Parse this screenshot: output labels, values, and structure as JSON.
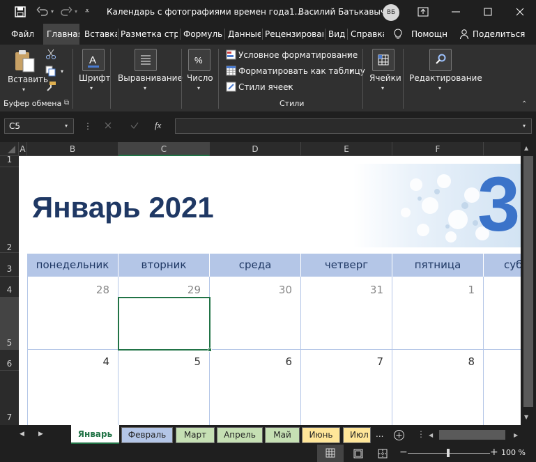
{
  "titlebar": {
    "doc_title": "Календарь с фотографиями времен года1...",
    "user_name": "Василий Батькавыч",
    "avatar_initials": "ВБ"
  },
  "tabs": [
    "Файл",
    "Главная",
    "Вставка",
    "Разметка стра",
    "Формулы",
    "Данные",
    "Рецензировани",
    "Вид",
    "Справка",
    "Помощн",
    "Поделиться"
  ],
  "ribbon": {
    "paste": "Вставить",
    "clipboard": "Буфер обмена",
    "font": "Шрифт",
    "align": "Выравнивание",
    "number": "Число",
    "cond_format": "Условное форматирование",
    "format_table": "Форматировать как таблицу",
    "cell_styles": "Стили ячеек",
    "styles": "Стили",
    "cells": "Ячейки",
    "editing": "Редактирование"
  },
  "formula": {
    "name_box": "C5",
    "fx": "fx"
  },
  "columns": [
    "A",
    "B",
    "C",
    "D",
    "E",
    "F"
  ],
  "rows": [
    "1",
    "2",
    "3",
    "4",
    "5",
    "6",
    "7"
  ],
  "calendar": {
    "title": "Январь 2021",
    "banner_number": "3",
    "days": [
      "понедельник",
      "вторник",
      "среда",
      "четверг",
      "пятница",
      "суб"
    ],
    "week1": [
      "28",
      "29",
      "30",
      "31",
      "1"
    ],
    "week2": [
      "4",
      "5",
      "6",
      "7",
      "8"
    ]
  },
  "sheets": [
    "Январь",
    "Февраль",
    "Март",
    "Апрель",
    "Май",
    "Июнь",
    "Июл"
  ],
  "sheet_more": "...",
  "status": {
    "zoom": "100 %"
  },
  "colors": {
    "title": "#1f3864",
    "header": "#b4c6e7",
    "selection": "#217346"
  }
}
